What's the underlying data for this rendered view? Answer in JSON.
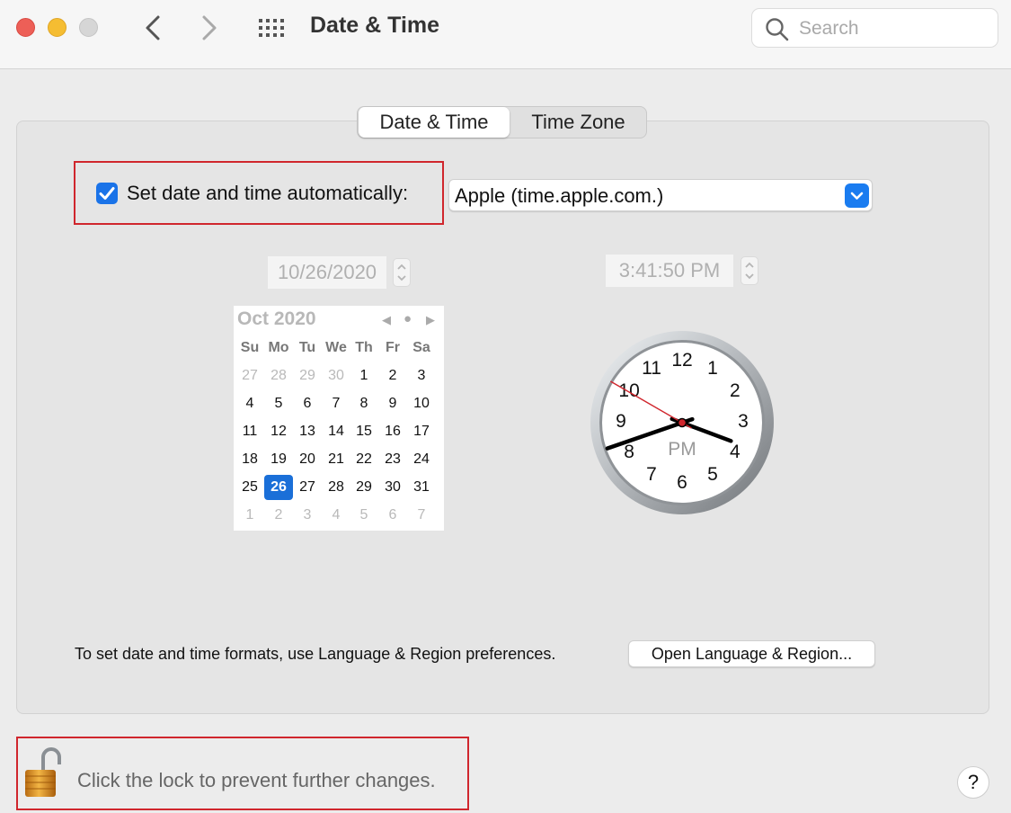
{
  "window": {
    "title": "Date & Time",
    "search_placeholder": "Search"
  },
  "tabs": [
    {
      "label": "Date & Time",
      "selected": true
    },
    {
      "label": "Time Zone",
      "selected": false
    }
  ],
  "auto": {
    "label": "Set date and time automatically:",
    "checked": true,
    "server": "Apple (time.apple.com.)"
  },
  "date_field": "10/26/2020",
  "time_field": "3:41:50 PM",
  "calendar": {
    "month": "Oct 2020",
    "weekdays": [
      "Su",
      "Mo",
      "Tu",
      "We",
      "Th",
      "Fr",
      "Sa"
    ],
    "weeks": [
      [
        "27",
        "28",
        "29",
        "30",
        "1",
        "2",
        "3"
      ],
      [
        "4",
        "5",
        "6",
        "7",
        "8",
        "9",
        "10"
      ],
      [
        "11",
        "12",
        "13",
        "14",
        "15",
        "16",
        "17"
      ],
      [
        "18",
        "19",
        "20",
        "21",
        "22",
        "23",
        "24"
      ],
      [
        "25",
        "26",
        "27",
        "28",
        "29",
        "30",
        "31"
      ],
      [
        "1",
        "2",
        "3",
        "4",
        "5",
        "6",
        "7"
      ]
    ],
    "selected_day": "26"
  },
  "clock": {
    "numbers": [
      "12",
      "1",
      "2",
      "3",
      "4",
      "5",
      "6",
      "7",
      "8",
      "9",
      "10",
      "11"
    ],
    "period": "PM",
    "hour": 3,
    "minute": 41,
    "second": 50
  },
  "formats_text": "To set date and time formats, use Language & Region preferences.",
  "open_button": "Open Language & Region...",
  "lock_text": "Click the lock to prevent further changes.",
  "help_label": "?",
  "colors": {
    "accent": "#1a73e8",
    "highlight_box": "#d0262d",
    "lock": "#d48a1e"
  }
}
